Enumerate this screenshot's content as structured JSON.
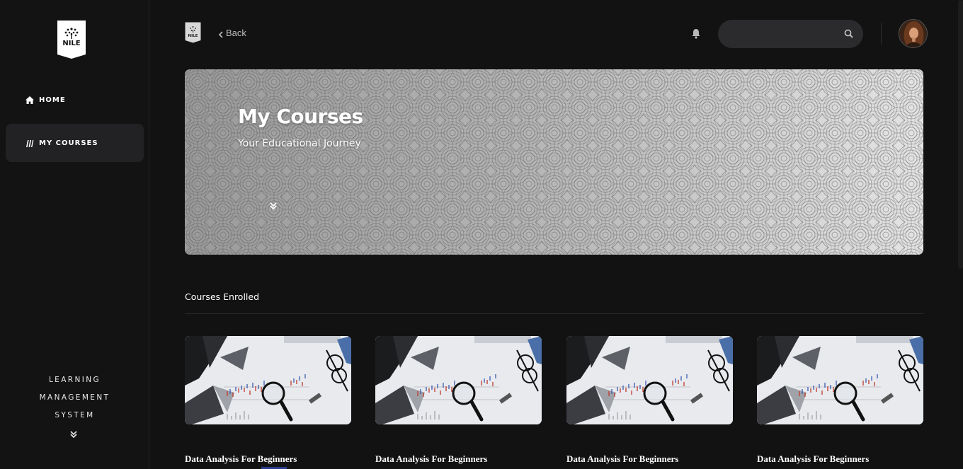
{
  "brand": {
    "logo_text": "NILE"
  },
  "sidebar": {
    "items": [
      {
        "label": "HOME",
        "icon": "home-icon",
        "active": false
      },
      {
        "label": "MY COURSES",
        "icon": "books-icon",
        "active": true
      }
    ],
    "footer_lines": [
      "LEARNING",
      "MANAGEMENT",
      "SYSTEM"
    ]
  },
  "header": {
    "back_label": "Back",
    "search": {
      "placeholder": "",
      "value": ""
    },
    "icons": [
      "bell-icon",
      "search-icon",
      "user-avatar"
    ]
  },
  "hero": {
    "title": "My Courses",
    "subtitle": "Your Educational Journey"
  },
  "section": {
    "title": "Courses Enrolled"
  },
  "courses": [
    {
      "title": "Data Analysis For Beginners"
    },
    {
      "title": "Data Analysis For Beginners"
    },
    {
      "title": "Data Analysis For Beginners"
    },
    {
      "title": "Data Analysis For Beginners"
    }
  ],
  "colors": {
    "background": "#121213",
    "sidebar_active": "#222224",
    "search_bg": "#2b2b2d"
  }
}
